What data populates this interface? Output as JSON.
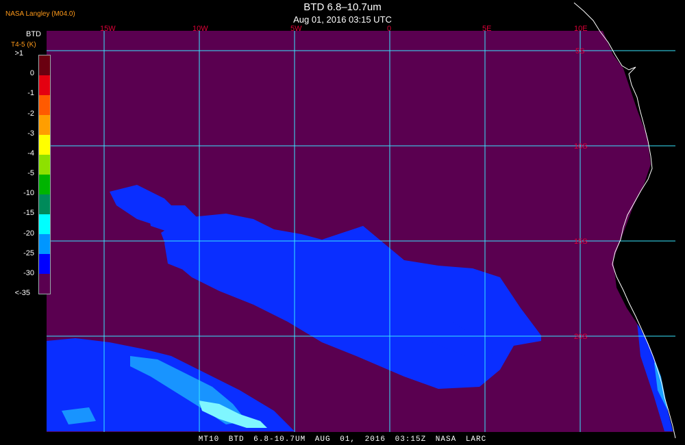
{
  "header": {
    "title": "BTD 6.8–10.7um",
    "subtitle": "Aug 01, 2016 03:15 UTC",
    "source": "NASA Langley (M04.0)"
  },
  "legend": {
    "title": "BTD",
    "subtitle": "T4-5 (K)",
    "labels": [
      ">1",
      "0",
      "-1",
      "-2",
      "-3",
      "-4",
      "-5",
      "-10",
      "-15",
      "-20",
      "-25",
      "-30",
      "<-35"
    ],
    "colors": [
      "#6a0010",
      "#e40010",
      "#ff5a00",
      "#ff9e00",
      "#ffff00",
      "#8ee000",
      "#00b400",
      "#008a5a",
      "#00ffff",
      "#0096ff",
      "#0000ff",
      "#5a0050"
    ]
  },
  "map": {
    "lon_labels": [
      "15W",
      "10W",
      "5W",
      "0",
      "5E",
      "10E"
    ],
    "lat_labels": [
      "5S",
      "10S",
      "15S",
      "20S"
    ],
    "colors": {
      "background": "#5a0050",
      "grid": "#38e8ff",
      "coast": "#ffffff",
      "cloud": "#0a2eff",
      "cloud_light": "#1aa0ff",
      "cloud_bright": "#7ff6ff"
    }
  },
  "footer": {
    "text": "MT10  BTD 6.8-10.7UM  AUG 01, 2016 03:15Z  NASA LARC"
  }
}
